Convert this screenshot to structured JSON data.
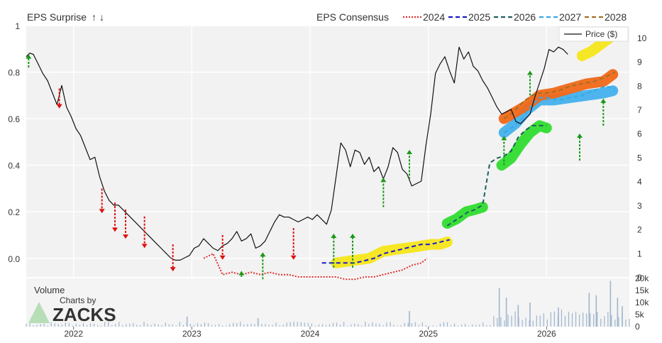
{
  "legend": {
    "eps_surprise_label": "EPS Surprise",
    "up_arrow": "↑",
    "down_arrow": "↓",
    "eps_consensus_label": "EPS Consensus",
    "price_label": "Price ($)",
    "volume_label": "Volume",
    "watermark_top": "Charts by",
    "watermark_brand": "ZACKS"
  },
  "colors": {
    "surprise_up": "#1a9a1a",
    "surprise_down": "#e01010",
    "c2024": "#e03030",
    "c2025": "#1a1acc",
    "c2026": "#1f5f5f",
    "c2027": "#39a8e0",
    "c2028": "#a07020",
    "band_yellow": "#f5e61a",
    "band_green": "#2fdc2f",
    "band_blue": "#43b0ec",
    "band_orange": "#f06818",
    "price": "#111111",
    "volume": "#9fb6cf",
    "panel_bg": "#f2f2f2",
    "grid": "#ffffff"
  },
  "chart_data": {
    "type": "line",
    "x_labels": [
      "2022",
      "2023",
      "2024",
      "2025",
      "2026"
    ],
    "left_axis": {
      "ticks": [
        "1",
        "0.8",
        "0.6",
        "0.4",
        "0.2",
        "0.0"
      ],
      "ylim": [
        -0.08,
        1.0
      ]
    },
    "right_axis": {
      "ticks": [
        "10",
        "9",
        "8",
        "7",
        "6",
        "5",
        "4",
        "3",
        "2",
        "1",
        "0"
      ],
      "ylim": [
        0,
        10.5
      ]
    },
    "volume_axis": {
      "ticks": [
        "20k",
        "15k",
        "10k",
        "5k",
        "0"
      ],
      "ylim": [
        0,
        20000
      ]
    },
    "consensus_series": [
      {
        "name": "2024",
        "color_key": "c2024",
        "style": "dotted"
      },
      {
        "name": "2025",
        "color_key": "c2025",
        "style": "dashed"
      },
      {
        "name": "2026",
        "color_key": "c2026",
        "style": "dashed"
      },
      {
        "name": "2027",
        "color_key": "c2027",
        "style": "dashed"
      },
      {
        "name": "2028",
        "color_key": "c2028",
        "style": "dashed"
      }
    ],
    "price_series": {
      "name": "Price ($)",
      "t": [
        2021.6,
        2021.63,
        2021.66,
        2021.7,
        2021.74,
        2021.78,
        2021.82,
        2021.86,
        2021.9,
        2021.94,
        2021.98,
        2022.02,
        2022.06,
        2022.1,
        2022.14,
        2022.18,
        2022.22,
        2022.26,
        2022.3,
        2022.34,
        2022.38,
        2022.42,
        2022.46,
        2022.5,
        2022.54,
        2022.58,
        2022.62,
        2022.66,
        2022.7,
        2022.74,
        2022.78,
        2022.82,
        2022.86,
        2022.9,
        2022.94,
        2022.98,
        2023.02,
        2023.06,
        2023.1,
        2023.14,
        2023.18,
        2023.22,
        2023.26,
        2023.3,
        2023.34,
        2023.38,
        2023.42,
        2023.46,
        2023.5,
        2023.54,
        2023.58,
        2023.62,
        2023.66,
        2023.7,
        2023.74,
        2023.78,
        2023.82,
        2023.86,
        2023.9,
        2023.94,
        2023.98,
        2024.02,
        2024.06,
        2024.1,
        2024.14,
        2024.18,
        2024.22,
        2024.26,
        2024.3,
        2024.34,
        2024.38,
        2024.42,
        2024.46,
        2024.5,
        2024.54,
        2024.58,
        2024.62,
        2024.66,
        2024.7,
        2024.74,
        2024.78,
        2024.82,
        2024.86,
        2024.9,
        2024.94,
        2024.98,
        2025.02,
        2025.06,
        2025.1,
        2025.14,
        2025.18,
        2025.22,
        2025.26,
        2025.3,
        2025.34,
        2025.38,
        2025.42,
        2025.46,
        2025.5,
        2025.54,
        2025.58,
        2025.62,
        2025.66,
        2025.7,
        2025.74,
        2025.78,
        2025.82,
        2025.86,
        2025.9,
        2025.94,
        2025.98,
        2026.02,
        2026.06,
        2026.1,
        2026.14,
        2026.18,
        2026.22,
        2026.26,
        2026.3,
        2026.34,
        2026.38,
        2026.42,
        2026.46,
        2026.5,
        2026.54,
        2026.58,
        2026.62,
        2026.66,
        2026.7
      ],
      "values": [
        9.2,
        9.35,
        9.3,
        8.9,
        8.5,
        8.2,
        7.7,
        7.2,
        8.0,
        7.1,
        6.7,
        6.2,
        5.9,
        5.4,
        4.9,
        5.0,
        4.2,
        3.6,
        3.2,
        3.0,
        3.0,
        2.8,
        2.6,
        2.4,
        2.2,
        2.0,
        1.8,
        1.6,
        1.4,
        1.2,
        1.0,
        0.8,
        0.7,
        0.7,
        0.8,
        0.9,
        1.2,
        1.3,
        1.6,
        1.4,
        1.2,
        1.1,
        1.3,
        1.4,
        1.6,
        1.9,
        1.5,
        1.6,
        1.8,
        1.2,
        1.3,
        1.5,
        1.9,
        2.3,
        2.6,
        2.5,
        2.5,
        2.4,
        2.3,
        2.4,
        2.5,
        2.4,
        2.6,
        2.4,
        2.2,
        2.8,
        4.2,
        5.6,
        5.3,
        4.6,
        5.3,
        5.2,
        4.7,
        5.0,
        4.4,
        4.6,
        4.1,
        4.6,
        5.4,
        5.2,
        4.5,
        4.3,
        3.8,
        3.9,
        4.0,
        5.5,
        6.8,
        8.5,
        8.9,
        9.2,
        8.6,
        8.1,
        9.6,
        9.1,
        9.4,
        8.8,
        8.6,
        8.2,
        7.9,
        7.5,
        7.1,
        6.8,
        6.9,
        7.0,
        6.5,
        6.4,
        6.6,
        6.8,
        7.5,
        8.1,
        8.7,
        9.5,
        9.4,
        9.6,
        9.5,
        9.3
      ],
      "ylim": [
        0,
        10.5
      ]
    },
    "consensus_data": {
      "2024": {
        "t": [
          2023.1,
          2023.18,
          2023.26,
          2023.34,
          2023.42,
          2023.5,
          2023.58,
          2023.66,
          2023.74,
          2023.82,
          2023.9,
          2023.98,
          2024.06,
          2024.14,
          2024.22,
          2024.3,
          2024.38,
          2024.46,
          2024.54,
          2024.62,
          2024.7,
          2024.78,
          2024.86,
          2024.94,
          2024.99
        ],
        "values": [
          0.0,
          0.02,
          -0.07,
          -0.06,
          -0.07,
          -0.06,
          -0.07,
          -0.06,
          -0.07,
          -0.07,
          -0.08,
          -0.08,
          -0.08,
          -0.08,
          -0.08,
          -0.09,
          -0.09,
          -0.08,
          -0.08,
          -0.07,
          -0.06,
          -0.05,
          -0.03,
          -0.02,
          0.0
        ]
      },
      "2025": {
        "t": [
          2024.1,
          2024.16,
          2024.22,
          2024.3,
          2024.38,
          2024.46,
          2024.54,
          2024.62,
          2024.7,
          2024.78,
          2024.86,
          2024.94,
          2025.02,
          2025.1,
          2025.18
        ],
        "values": [
          -0.02,
          -0.02,
          -0.02,
          -0.02,
          -0.02,
          -0.01,
          0.0,
          0.02,
          0.03,
          0.04,
          0.05,
          0.06,
          0.06,
          0.07,
          0.08
        ]
      },
      "2026": {
        "t": [
          2025.16,
          2025.22,
          2025.28,
          2025.34,
          2025.4,
          2025.46,
          2025.52,
          2025.58,
          2025.64,
          2025.7,
          2025.76,
          2025.82,
          2025.88,
          2025.94,
          2026.0
        ],
        "values": [
          0.14,
          0.16,
          0.18,
          0.2,
          0.21,
          0.23,
          0.41,
          0.43,
          0.44,
          0.46,
          0.52,
          0.55,
          0.57,
          0.57,
          0.57
        ]
      },
      "2027": {
        "t": [
          2025.64,
          2025.7,
          2025.76,
          2025.82,
          2025.88,
          2025.94,
          2026.0,
          2026.1,
          2026.2,
          2026.3,
          2026.4,
          2026.5,
          2026.58
        ],
        "values": [
          0.54,
          0.56,
          0.58,
          0.62,
          0.66,
          0.69,
          0.69,
          0.68,
          0.69,
          0.7,
          0.72,
          0.74,
          0.73
        ]
      },
      "2028": {
        "t": [
          2025.64,
          2025.7,
          2025.76,
          2025.82,
          2025.88,
          2025.94,
          2026.0,
          2026.1,
          2026.2,
          2026.3,
          2026.4,
          2026.5,
          2026.58
        ],
        "values": [
          0.6,
          0.62,
          0.65,
          0.68,
          0.7,
          0.71,
          0.71,
          0.72,
          0.74,
          0.75,
          0.76,
          0.78,
          0.8
        ]
      }
    },
    "bands": [
      {
        "color_key": "band_yellow",
        "t": [
          2024.22,
          2024.35,
          2024.5,
          2024.62,
          2024.75,
          2024.9,
          2025.02,
          2025.1,
          2025.16
        ],
        "values": [
          -0.02,
          -0.01,
          0.0,
          0.03,
          0.04,
          0.05,
          0.06,
          0.06,
          0.07
        ]
      },
      {
        "color_key": "band_green",
        "t": [
          2025.16,
          2025.24,
          2025.32,
          2025.4,
          2025.46
        ],
        "values": [
          0.15,
          0.17,
          0.2,
          0.21,
          0.22
        ]
      },
      {
        "color_key": "band_green",
        "t": [
          2025.62,
          2025.7,
          2025.78,
          2025.86,
          2025.94,
          2026.0
        ],
        "values": [
          0.4,
          0.43,
          0.49,
          0.54,
          0.57,
          0.56
        ]
      },
      {
        "color_key": "band_blue",
        "t": [
          2025.64,
          2025.74,
          2025.84,
          2025.94,
          2026.06,
          2026.2,
          2026.34,
          2026.48,
          2026.56
        ],
        "values": [
          0.54,
          0.58,
          0.64,
          0.68,
          0.68,
          0.69,
          0.7,
          0.71,
          0.72
        ]
      },
      {
        "color_key": "band_orange",
        "t": [
          2025.64,
          2025.74,
          2025.84,
          2025.94,
          2026.06,
          2026.2,
          2026.34,
          2026.48,
          2026.56
        ],
        "values": [
          0.6,
          0.63,
          0.66,
          0.7,
          0.71,
          0.73,
          0.75,
          0.76,
          0.79
        ]
      },
      {
        "color_key": "band_yellow",
        "t": [
          2026.3,
          2026.38,
          2026.46,
          2026.54
        ],
        "values": [
          0.87,
          0.89,
          0.92,
          0.95
        ]
      }
    ],
    "surprises": [
      {
        "t": 2021.62,
        "dir": "up",
        "from": 0.82,
        "to": 0.87
      },
      {
        "t": 2021.88,
        "dir": "down",
        "from": 0.73,
        "to": 0.65
      },
      {
        "t": 2022.24,
        "dir": "down",
        "from": 0.3,
        "to": 0.2
      },
      {
        "t": 2022.35,
        "dir": "down",
        "from": 0.24,
        "to": 0.12
      },
      {
        "t": 2022.44,
        "dir": "down",
        "from": 0.21,
        "to": 0.09
      },
      {
        "t": 2022.6,
        "dir": "down",
        "from": 0.18,
        "to": 0.05
      },
      {
        "t": 2022.84,
        "dir": "down",
        "from": 0.06,
        "to": -0.05
      },
      {
        "t": 2023.26,
        "dir": "down",
        "from": 0.1,
        "to": 0.0
      },
      {
        "t": 2023.42,
        "dir": "up",
        "from": -0.08,
        "to": -0.06
      },
      {
        "t": 2023.6,
        "dir": "up",
        "from": -0.09,
        "to": 0.02
      },
      {
        "t": 2023.86,
        "dir": "down",
        "from": 0.13,
        "to": 0.0
      },
      {
        "t": 2024.2,
        "dir": "up",
        "from": -0.04,
        "to": 0.1
      },
      {
        "t": 2024.36,
        "dir": "up",
        "from": -0.04,
        "to": 0.1
      },
      {
        "t": 2024.62,
        "dir": "up",
        "from": 0.22,
        "to": 0.34
      },
      {
        "t": 2024.84,
        "dir": "up",
        "from": 0.34,
        "to": 0.46
      },
      {
        "t": 2025.64,
        "dir": "up",
        "from": 0.4,
        "to": 0.52
      },
      {
        "t": 2025.86,
        "dir": "up",
        "from": 0.7,
        "to": 0.8
      },
      {
        "t": 2026.28,
        "dir": "up",
        "from": 0.42,
        "to": 0.53
      },
      {
        "t": 2026.48,
        "dir": "up",
        "from": 0.57,
        "to": 0.68
      }
    ],
    "volume_series": {
      "name": "Volume",
      "t_start": 2021.6,
      "t_end": 2026.7,
      "count": 170,
      "spikes": [
        {
          "t": 2022.96,
          "v": 4200
        },
        {
          "t": 2023.56,
          "v": 3500
        },
        {
          "t": 2024.84,
          "v": 6500
        },
        {
          "t": 2025.6,
          "v": 16000
        },
        {
          "t": 2025.66,
          "v": 12000
        },
        {
          "t": 2025.76,
          "v": 9000
        },
        {
          "t": 2025.86,
          "v": 10000
        },
        {
          "t": 2026.1,
          "v": 8000
        },
        {
          "t": 2026.36,
          "v": 14000
        },
        {
          "t": 2026.42,
          "v": 13000
        },
        {
          "t": 2026.54,
          "v": 19000
        },
        {
          "t": 2026.6,
          "v": 12000
        },
        {
          "t": 2026.64,
          "v": 8500
        }
      ],
      "ylim": [
        0,
        20000
      ]
    }
  }
}
